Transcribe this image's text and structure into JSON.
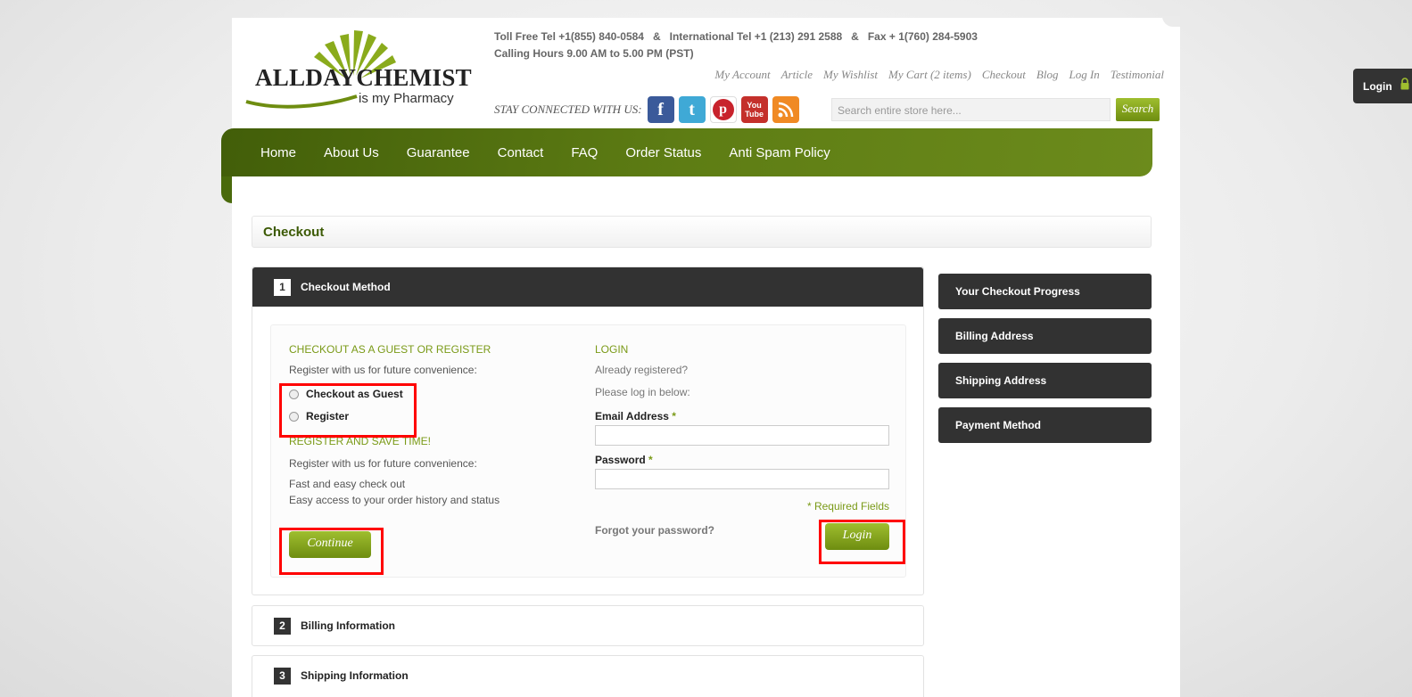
{
  "header": {
    "logo_text": "ALLDAYCHEMIST",
    "logo_tagline": "is my Pharmacy",
    "contact_line1": "Toll Free Tel +1(855) 840-0584   &   International Tel +1 (213) 291 2588   &   Fax + 1(760) 284-5903",
    "contact_line2": "Calling Hours 9.00 AM to 5.00 PM (PST)",
    "top_links": [
      "My Account",
      "Article",
      "My Wishlist",
      "My Cart (2 items)",
      "Checkout",
      "Blog",
      "Log In",
      "Testimonial"
    ],
    "social_label": "STAY CONNECTED WITH US:",
    "social_icons": [
      "facebook-icon",
      "twitter-icon",
      "pinterest-icon",
      "youtube-icon",
      "rss-icon"
    ],
    "search_placeholder": "Search entire store here...",
    "search_button": "Search",
    "login_tab": "Login"
  },
  "nav": [
    "Home",
    "About Us",
    "Guarantee",
    "Contact",
    "FAQ",
    "Order Status",
    "Anti Spam Policy"
  ],
  "page_title": "Checkout",
  "steps": [
    {
      "num": "1",
      "title": "Checkout Method"
    },
    {
      "num": "2",
      "title": "Billing Information"
    },
    {
      "num": "3",
      "title": "Shipping Information"
    }
  ],
  "guest": {
    "heading": "CHECKOUT AS A GUEST OR REGISTER",
    "intro": "Register with us for future convenience:",
    "option_guest": "Checkout as Guest",
    "option_register": "Register",
    "register_heading": "REGISTER AND SAVE TIME!",
    "register_intro": "Register with us for future convenience:",
    "benefit1": "Fast and easy check out",
    "benefit2": "Easy access to your order history and status",
    "continue_button": "Continue"
  },
  "login": {
    "heading": "LOGIN",
    "line1": "Already registered?",
    "line2": "Please log in below:",
    "email_label": "Email Address",
    "password_label": "Password",
    "required_mark": "*",
    "required_note": "* Required Fields",
    "forgot": "Forgot your password?",
    "login_button": "Login"
  },
  "sidebar": [
    "Your Checkout Progress",
    "Billing Address",
    "Shipping Address",
    "Payment Method"
  ],
  "colors": {
    "accent_green": "#7a9a17",
    "nav_green": "#5e7d14",
    "dark": "#323232",
    "highlight": "#ff0000"
  }
}
